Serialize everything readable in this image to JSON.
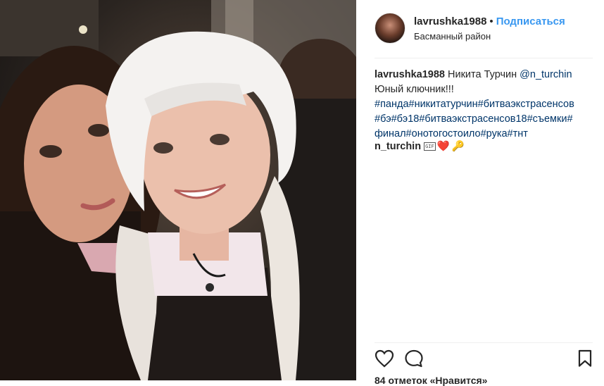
{
  "header": {
    "username": "lavrushka1988",
    "separator": "•",
    "follow_label": "Подписаться",
    "location": "Басманный район"
  },
  "caption": {
    "username": "lavrushka1988",
    "text_before_mention": "Никита Турчин",
    "mention": "@n_turchin",
    "line2": "Юный ключник!!!",
    "hashtags": [
      "#панда#никитатурчин#битваэкстрасенсов",
      "#бэ#бэ18#битваэкстрасенсов18#съемки#",
      "финал#онотогостоило#рука#тнт"
    ]
  },
  "comment": {
    "username": "n_turchin",
    "gif_badge": "GIF",
    "heart": "❤️",
    "key": "🔑"
  },
  "likes": {
    "text": "84 отметок «Нравится»"
  },
  "icons": [
    "heart-icon",
    "comment-icon",
    "bookmark-icon"
  ],
  "colors": {
    "link": "#003569",
    "follow": "#3897f0",
    "text": "#262626",
    "divider": "#efefef"
  }
}
